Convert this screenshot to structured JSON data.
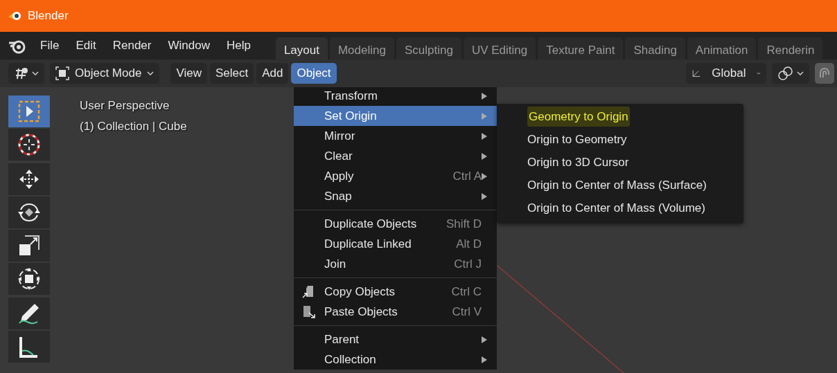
{
  "window": {
    "title": "Blender"
  },
  "menubar": [
    {
      "label": "File"
    },
    {
      "label": "Edit"
    },
    {
      "label": "Render"
    },
    {
      "label": "Window"
    },
    {
      "label": "Help"
    }
  ],
  "workspace_tabs": [
    {
      "label": "Layout",
      "selected": true
    },
    {
      "label": "Modeling",
      "selected": false
    },
    {
      "label": "Sculpting",
      "selected": false
    },
    {
      "label": "UV Editing",
      "selected": false
    },
    {
      "label": "Texture Paint",
      "selected": false
    },
    {
      "label": "Shading",
      "selected": false
    },
    {
      "label": "Animation",
      "selected": false
    },
    {
      "label": "Renderin",
      "selected": false
    }
  ],
  "header": {
    "mode": "Object Mode",
    "menus": [
      {
        "label": "View",
        "selected": false
      },
      {
        "label": "Select",
        "selected": false
      },
      {
        "label": "Add",
        "selected": false
      },
      {
        "label": "Object",
        "selected": true
      }
    ],
    "orientation": "Global"
  },
  "tool_groups": [
    {
      "tools": [
        {
          "kind": "select",
          "selected": true
        },
        {
          "kind": "cursor",
          "selected": false
        }
      ]
    },
    {
      "tools": [
        {
          "kind": "move",
          "selected": false
        },
        {
          "kind": "rotate",
          "selected": false
        },
        {
          "kind": "scale",
          "selected": false
        },
        {
          "kind": "transform",
          "selected": false
        }
      ]
    },
    {
      "tools": [
        {
          "kind": "annotate",
          "selected": false
        },
        {
          "kind": "measure",
          "selected": false
        }
      ]
    }
  ],
  "viewport": {
    "overlay_lines": [
      "User Perspective",
      "(1) Collection | Cube"
    ]
  },
  "object_menu": [
    {
      "kind": "item",
      "label": "Transform",
      "submenu": true,
      "selected": false
    },
    {
      "kind": "item",
      "label": "Set Origin",
      "submenu": true,
      "selected": true
    },
    {
      "kind": "item",
      "label": "Mirror",
      "submenu": true,
      "selected": false
    },
    {
      "kind": "item",
      "label": "Clear",
      "submenu": true,
      "selected": false
    },
    {
      "kind": "item",
      "label": "Apply",
      "shortcut": "Ctrl A",
      "submenu": true,
      "selected": false
    },
    {
      "kind": "item",
      "label": "Snap",
      "submenu": true,
      "selected": false
    },
    {
      "kind": "separator"
    },
    {
      "kind": "item",
      "label": "Duplicate Objects",
      "shortcut": "Shift D",
      "submenu": false,
      "selected": false
    },
    {
      "kind": "item",
      "label": "Duplicate Linked",
      "shortcut": "Alt D",
      "submenu": false,
      "selected": false
    },
    {
      "kind": "item",
      "label": "Join",
      "shortcut": "Ctrl J",
      "submenu": false,
      "selected": false
    },
    {
      "kind": "separator"
    },
    {
      "kind": "item",
      "label": "Copy Objects",
      "shortcut": "Ctrl C",
      "submenu": false,
      "selected": false
    },
    {
      "kind": "item",
      "label": "Paste Objects",
      "shortcut": "Ctrl V",
      "submenu": false,
      "selected": false
    },
    {
      "kind": "separator"
    },
    {
      "kind": "item",
      "label": "Parent",
      "submenu": true,
      "selected": false
    },
    {
      "kind": "item",
      "label": "Collection",
      "submenu": true,
      "selected": false
    }
  ],
  "set_origin_menu": [
    {
      "label": "Geometry to Origin",
      "selected": true
    },
    {
      "label": "Origin to Geometry",
      "selected": false
    },
    {
      "label": "Origin to 3D Cursor",
      "selected": false
    },
    {
      "label": "Origin to Center of Mass (Surface)",
      "selected": false
    },
    {
      "label": "Origin to Center of Mass (Volume)",
      "selected": false
    }
  ]
}
